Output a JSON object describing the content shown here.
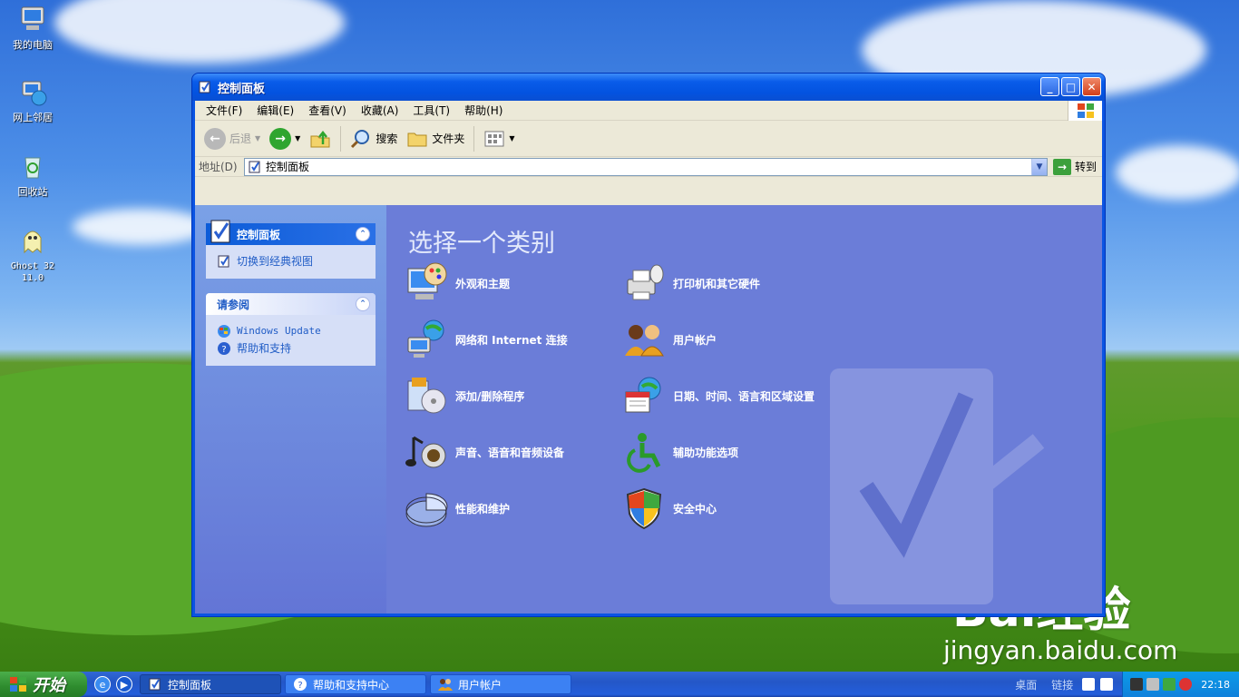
{
  "desktop": {
    "icons": [
      {
        "label": "我的电脑",
        "icon": "my-computer-icon"
      },
      {
        "label": "网上邻居",
        "icon": "network-places-icon"
      },
      {
        "label": "回收站",
        "icon": "recycle-bin-icon"
      },
      {
        "label": "Ghost 32 11.0",
        "icon": "ghost-icon"
      }
    ]
  },
  "window": {
    "title": "控制面板",
    "menu": [
      "文件(F)",
      "编辑(E)",
      "查看(V)",
      "收藏(A)",
      "工具(T)",
      "帮助(H)"
    ],
    "toolbar": {
      "back": "后退",
      "search": "搜索",
      "folders": "文件夹"
    },
    "address": {
      "label": "地址(D)",
      "value": "控制面板",
      "go": "转到"
    },
    "sidebar": {
      "panel1_title": "控制面板",
      "panel1_link": "切换到经典视图",
      "panel2_title": "请参阅",
      "panel2_links": [
        "Windows Update",
        "帮助和支持"
      ]
    },
    "main": {
      "heading": "选择一个类别",
      "categories": [
        "外观和主题",
        "打印机和其它硬件",
        "网络和 Internet 连接",
        "用户帐户",
        "添加/删除程序",
        "日期、时间、语言和区域设置",
        "声音、语音和音频设备",
        "辅助功能选项",
        "性能和维护",
        "安全中心"
      ]
    }
  },
  "taskbar": {
    "start": "开始",
    "tasks": [
      "控制面板",
      "帮助和支持中心",
      "用户帐户"
    ],
    "links": [
      "桌面",
      "链接"
    ],
    "clock": "22:18"
  },
  "watermark": {
    "brand": "Bai经验",
    "url": "jingyan.baidu.com"
  }
}
